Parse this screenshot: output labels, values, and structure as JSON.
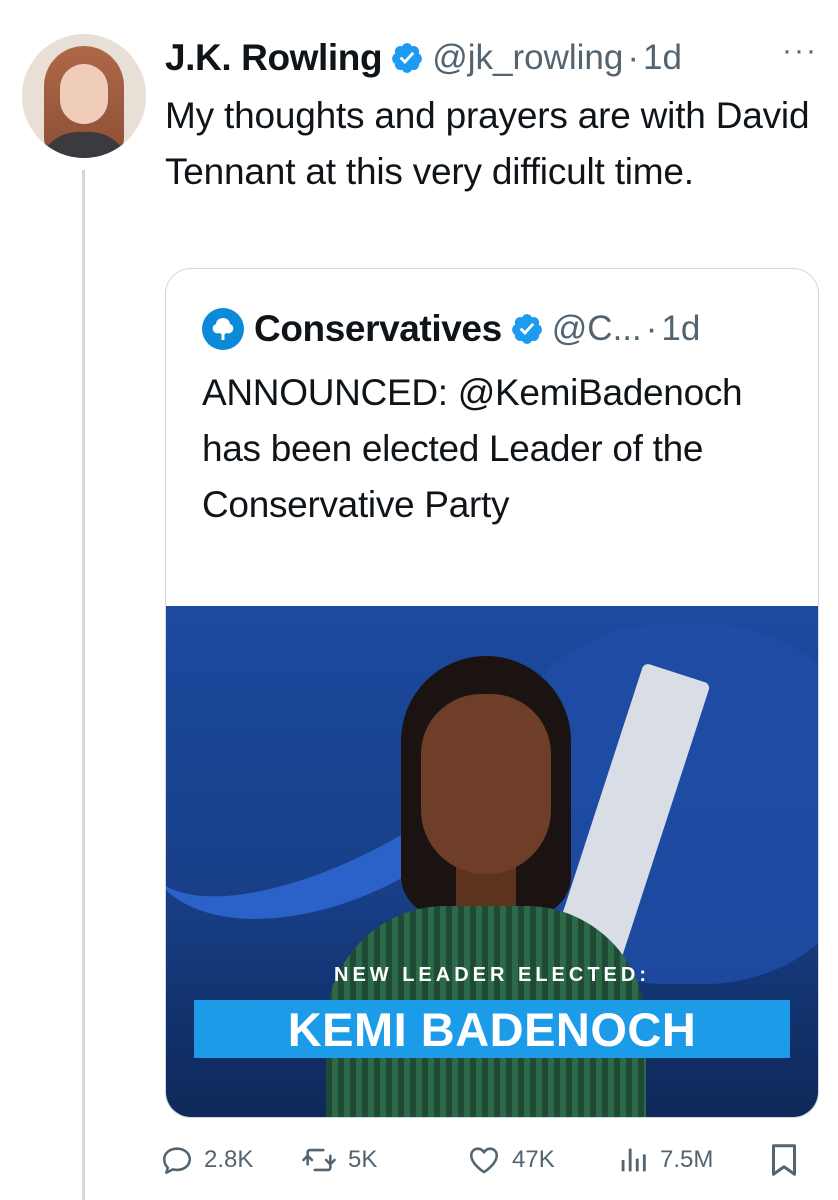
{
  "tweet": {
    "author_name": "J.K. Rowling",
    "handle": "@jk_rowling",
    "separator": "·",
    "time": "1d",
    "more": "···",
    "text": "My thoughts and prayers are with David Tennant at this very difficult time."
  },
  "quoted": {
    "author_name": "Conservatives",
    "handle": "@C...",
    "separator": "·",
    "time": "1d",
    "text": "ANNOUNCED: @KemiBadenoch has been elected Leader of the Conservative Party",
    "image": {
      "banner_small": "NEW LEADER ELECTED:",
      "banner_big": "KEMI BADENOCH"
    }
  },
  "actions": {
    "replies": "2.8K",
    "reposts": "5K",
    "likes": "47K",
    "views": "7.5M"
  },
  "colors": {
    "verified": "#1d9bf0",
    "secondary_text": "#536471",
    "banner": "#1c9be8",
    "image_bg": "#1c4aa0"
  },
  "icons": [
    "verified-badge-icon",
    "more-icon",
    "conservatives-tree-logo",
    "reply-icon",
    "repost-icon",
    "like-icon",
    "views-icon",
    "bookmark-icon"
  ]
}
